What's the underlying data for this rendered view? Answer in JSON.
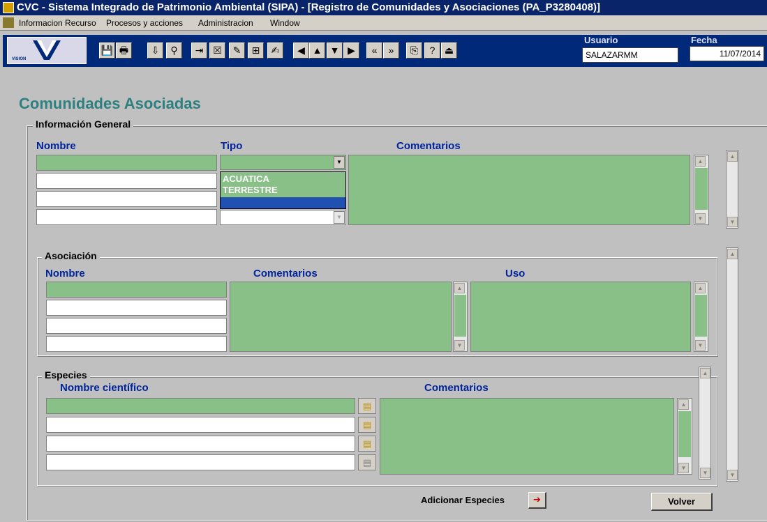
{
  "window": {
    "title": "CVC - Sistema Integrado de Patrimonio Ambiental (SIPA) - [Registro de Comunidades y Asociaciones (PA_P3280408)]"
  },
  "menu": {
    "items": [
      "Informacion Recurso",
      "Procesos y acciones",
      "Administracion",
      "Window"
    ]
  },
  "toolbar": {
    "logo_text": "VISION",
    "user_label": "Usuario",
    "user_value": "SALAZARMM",
    "date_label": "Fecha",
    "date_value": "11/07/2014",
    "icons": [
      "save-icon",
      "print-icon",
      "download-icon",
      "query-icon",
      "insert-record-icon",
      "delete-record-icon",
      "edit-icon",
      "lookup-icon",
      "write-icon",
      "first-record-icon",
      "previous-record-icon",
      "next-record-icon",
      "last-record-icon",
      "previous-block-icon",
      "next-block-icon",
      "copy-icon",
      "help-icon",
      "exit-icon"
    ]
  },
  "page": {
    "title": "Comunidades Asociadas"
  },
  "general": {
    "label": "Información General",
    "col_nombre": "Nombre",
    "col_tipo": "Tipo",
    "col_comentarios": "Comentarios",
    "tipo_options": [
      "ACUATICA",
      "TERRESTRE",
      ""
    ]
  },
  "asociacion": {
    "label": "Asociación",
    "col_nombre": "Nombre",
    "col_comentarios": "Comentarios",
    "col_uso": "Uso"
  },
  "especies": {
    "label": "Especies",
    "col_nombre": "Nombre científico",
    "col_comentarios": "Comentarios",
    "add_label": "Adicionar Especies"
  },
  "buttons": {
    "volver": "Volver"
  },
  "colors": {
    "title_bar": "#0a246a",
    "toolbar": "#00297a",
    "field_green": "#88c088",
    "heading": "#2e7f7f",
    "column_header": "#00249c"
  }
}
